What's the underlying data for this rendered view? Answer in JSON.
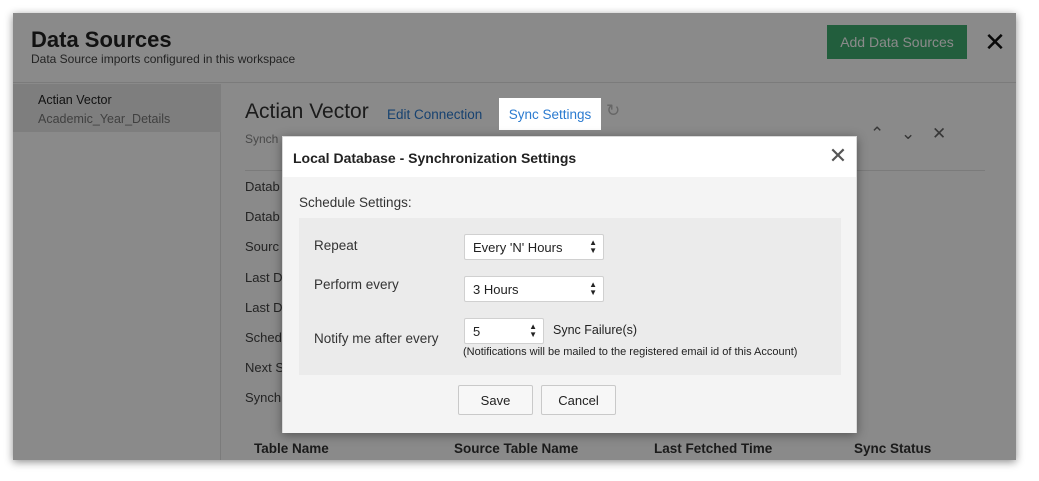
{
  "header": {
    "title": "Data Sources",
    "subtitle": "Data Source imports configured in this workspace",
    "add_button": "Add Data Sources",
    "close_glyph": "✕"
  },
  "sidebar": {
    "items": [
      {
        "name": "Actian Vector",
        "sub": "Academic_Year_Details"
      }
    ]
  },
  "content": {
    "title": "Actian Vector",
    "edit_link": "Edit Connection",
    "sync_tab": "Sync Settings",
    "sub": "Synch",
    "labels": [
      "Datab",
      "Datab",
      "Sourc",
      "Last D",
      "Last D",
      "Sched",
      "Next S",
      "Synch"
    ],
    "table_headers": [
      "Table Name",
      "Source Table Name",
      "Last Fetched Time",
      "Sync Status"
    ]
  },
  "dialog": {
    "title": "Local Database - Synchronization Settings",
    "schedule_label": "Schedule Settings:",
    "repeat_label": "Repeat",
    "repeat_value": "Every 'N' Hours",
    "perform_label": "Perform every",
    "perform_value": "3 Hours",
    "notify_label": "Notify me after every",
    "notify_value": "5",
    "sync_failure": "Sync Failure(s)",
    "note": "(Notifications will be mailed to the registered email id of this Account)",
    "save": "Save",
    "cancel": "Cancel"
  },
  "colors": {
    "accent_green": "#3fae71",
    "link_blue": "#2b7bd0"
  },
  "icons": {
    "refresh": "refresh-icon",
    "chevron_up": "chevron-up-icon",
    "chevron_down": "chevron-down-icon",
    "close": "close-icon"
  }
}
